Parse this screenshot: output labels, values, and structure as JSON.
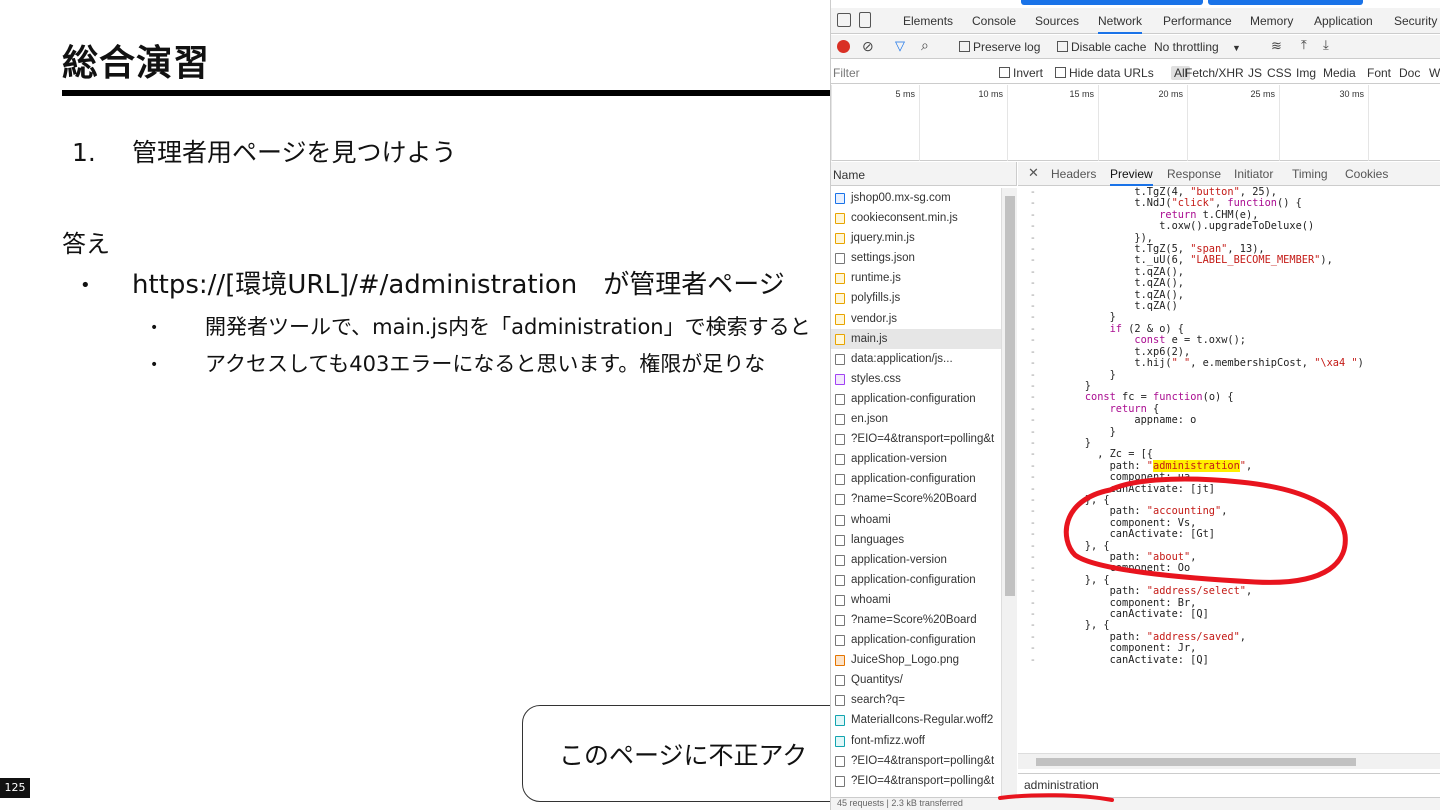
{
  "slide": {
    "title": "総合演習",
    "step_number": "1.",
    "step_text": "管理者用ページを見つけよう",
    "answer_label": "答え",
    "bullet_main": "https://[環境URL]/#/administration　が管理者ページ",
    "sub_bullets": [
      "開発者ツールで、main.js内を「administration」で検索すると",
      "アクセスしても403エラーになると思います。権限が足りな"
    ],
    "callout_text": "このページに不正アク",
    "page_number": "125"
  },
  "devtools": {
    "tabs": [
      "Elements",
      "Console",
      "Sources",
      "Network",
      "Performance",
      "Memory",
      "Application",
      "Security"
    ],
    "active_tab": "Network",
    "toolbar": {
      "preserve_log": "Preserve log",
      "disable_cache": "Disable cache",
      "throttling": "No throttling"
    },
    "filter": {
      "placeholder": "Filter",
      "invert": "Invert",
      "hide_data_urls": "Hide data URLs",
      "types": [
        "All",
        "Fetch/XHR",
        "JS",
        "CSS",
        "Img",
        "Media",
        "Font",
        "Doc",
        "W"
      ]
    },
    "timeline_ticks": [
      "5 ms",
      "10 ms",
      "15 ms",
      "20 ms",
      "25 ms",
      "30 ms",
      "3"
    ],
    "name_header": "Name",
    "requests": [
      {
        "name": "jshop00.mx-sg.com",
        "type": "doc"
      },
      {
        "name": "cookieconsent.min.js",
        "type": "js"
      },
      {
        "name": "jquery.min.js",
        "type": "js"
      },
      {
        "name": "settings.json",
        "type": "other"
      },
      {
        "name": "runtime.js",
        "type": "js"
      },
      {
        "name": "polyfills.js",
        "type": "js"
      },
      {
        "name": "vendor.js",
        "type": "js"
      },
      {
        "name": "main.js",
        "type": "js"
      },
      {
        "name": "data:application/js...",
        "type": "other"
      },
      {
        "name": "styles.css",
        "type": "css"
      },
      {
        "name": "application-configuration",
        "type": "other"
      },
      {
        "name": "en.json",
        "type": "other"
      },
      {
        "name": "?EIO=4&transport=polling&t",
        "type": "other"
      },
      {
        "name": "application-version",
        "type": "other"
      },
      {
        "name": "application-configuration",
        "type": "other"
      },
      {
        "name": "?name=Score%20Board",
        "type": "other"
      },
      {
        "name": "whoami",
        "type": "other"
      },
      {
        "name": "languages",
        "type": "other"
      },
      {
        "name": "application-version",
        "type": "other"
      },
      {
        "name": "application-configuration",
        "type": "other"
      },
      {
        "name": "whoami",
        "type": "other"
      },
      {
        "name": "?name=Score%20Board",
        "type": "other"
      },
      {
        "name": "application-configuration",
        "type": "other"
      },
      {
        "name": "JuiceShop_Logo.png",
        "type": "img"
      },
      {
        "name": "Quantitys/",
        "type": "other"
      },
      {
        "name": "search?q=",
        "type": "other"
      },
      {
        "name": "MaterialIcons-Regular.woff2",
        "type": "font"
      },
      {
        "name": "font-mfizz.woff",
        "type": "font"
      },
      {
        "name": "?EIO=4&transport=polling&t",
        "type": "other"
      },
      {
        "name": "?EIO=4&transport=polling&t",
        "type": "other"
      }
    ],
    "detail_tabs": [
      "Headers",
      "Preview",
      "Response",
      "Initiator",
      "Timing",
      "Cookies"
    ],
    "active_detail_tab": "Preview",
    "code_lines": [
      "            t.TgZ(4, \"button\", 25),",
      "            t.NdJ(\"click\", function() {",
      "                return t.CHM(e),",
      "                t.oxw().upgradeToDeluxe()",
      "            }),",
      "            t.TgZ(5, \"span\", 13),",
      "            t._uU(6, \"LABEL_BECOME_MEMBER\"),",
      "            t.qZA(),",
      "            t.qZA(),",
      "            t.qZA(),",
      "            t.qZA()",
      "        }",
      "        if (2 & o) {",
      "            const e = t.oxw();",
      "            t.xp6(2),",
      "            t.hij(\" \", e.membershipCost, \"\\xa4 \")",
      "        }",
      "    }",
      "    const fc = function(o) {",
      "        return {",
      "            appname: o",
      "        }",
      "    }",
      "      , Zc = [{",
      "        path: \"administration\",",
      "        component: ua,",
      "        canActivate: [jt]",
      "    }, {",
      "        path: \"accounting\",",
      "        component: Vs,",
      "        canActivate: [Gt]",
      "    }, {",
      "        path: \"about\",",
      "        component: Oo",
      "    }, {",
      "        path: \"address/select\",",
      "        component: Br,",
      "        canActivate: [Q]",
      "    }, {",
      "        path: \"address/saved\",",
      "        component: Jr,",
      "        canActivate: [Q]"
    ],
    "search_value": "administration",
    "status_text": "45 requests  |  2.3 kB transferred",
    "colors": {
      "accent": "#1a73e8",
      "highlight": "#ffef00",
      "annotation": "#e8141e"
    }
  }
}
